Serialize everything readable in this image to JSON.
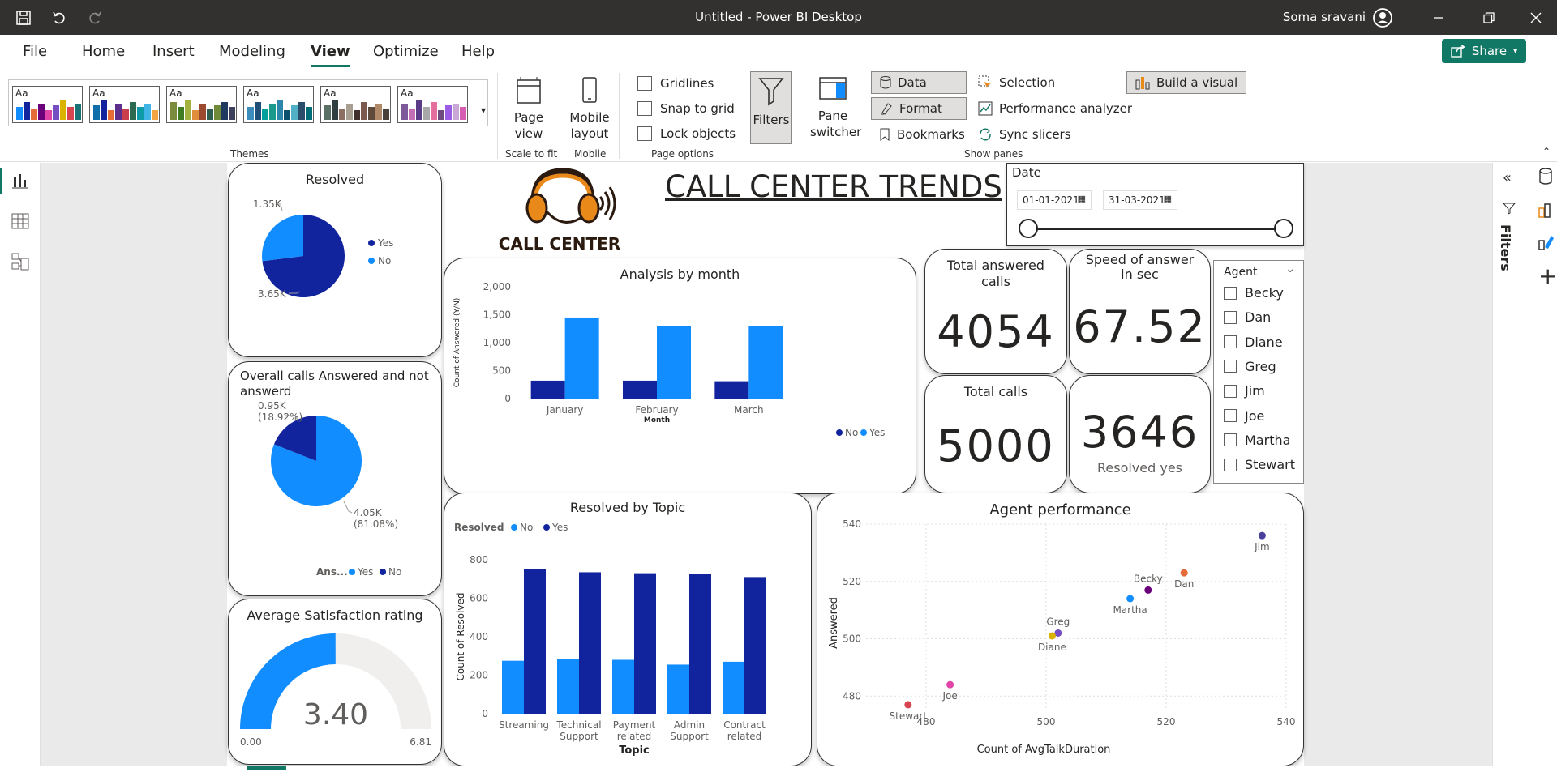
{
  "window": {
    "title": "Untitled - Power BI Desktop",
    "user": "Soma sravani"
  },
  "menu": {
    "tabs": [
      "File",
      "Home",
      "Insert",
      "Modeling",
      "View",
      "Optimize",
      "Help"
    ],
    "active": "View",
    "share_label": "Share"
  },
  "ribbon": {
    "themes_label": "Themes",
    "theme_aa": "Aa",
    "page_view": "Page view",
    "scale_to_fit": "Scale to fit",
    "mobile_layout": "Mobile layout",
    "mobile": "Mobile",
    "gridlines": "Gridlines",
    "snap_to_grid": "Snap to grid",
    "lock_objects": "Lock objects",
    "page_options": "Page options",
    "filters": "Filters",
    "pane_switcher": "Pane switcher",
    "data": "Data",
    "format": "Format",
    "bookmarks": "Bookmarks",
    "selection": "Selection",
    "performance_analyzer": "Performance analyzer",
    "sync_slicers": "Sync slicers",
    "build_visual": "Build a visual",
    "show_panes": "Show panes"
  },
  "right_pane": {
    "filters_label": "Filters"
  },
  "colors": {
    "accent": "#117865",
    "dark_blue": "#12239E",
    "light_blue": "#118DFF",
    "header_orange": "#E8891A"
  },
  "header": {
    "title": "CALL CENTER TRENDS",
    "logo_text": "CALL CENTER"
  },
  "date_slicer": {
    "label": "Date",
    "start": "01-01-2021",
    "end": "31-03-2021"
  },
  "agent_slicer": {
    "label": "Agent",
    "agents": [
      "Becky",
      "Dan",
      "Diane",
      "Greg",
      "Jim",
      "Joe",
      "Martha",
      "Stewart"
    ]
  },
  "kpis": {
    "total_answered": {
      "label": "Total answered calls",
      "value": "4054"
    },
    "speed_answer": {
      "label": "Speed of answer in sec",
      "value": "67.52"
    },
    "total_calls": {
      "label": "Total calls",
      "value": "5000"
    },
    "resolved_yes": {
      "label": "Resolved yes",
      "value": "3646"
    }
  },
  "gauge": {
    "title": "Average Satisfaction rating",
    "value": "3.40",
    "min": "0.00",
    "max": "6.81"
  },
  "chart_data": [
    {
      "type": "pie",
      "title": "Resolved",
      "labels": [
        "Yes",
        "No"
      ],
      "values": [
        3.65,
        1.35
      ],
      "value_labels": [
        "3.65K",
        "1.35K"
      ],
      "colors": [
        "#12239E",
        "#118DFF"
      ],
      "legend": "right"
    },
    {
      "type": "pie",
      "title": "Overall calls Answered and not answerd",
      "legend_title": "Ans...",
      "labels": [
        "Yes",
        "No"
      ],
      "values": [
        4.05,
        0.95
      ],
      "value_labels": [
        "4.05K\n(81.08%)",
        "0.95K\n(18.92%)"
      ],
      "colors": [
        "#118DFF",
        "#12239E"
      ],
      "legend": "bottom-right"
    },
    {
      "type": "bar",
      "title": "Analysis by month",
      "xlabel": "Month",
      "ylabel": "Count of Answered (Y/N)",
      "categories": [
        "January",
        "February",
        "March"
      ],
      "series": [
        {
          "name": "No",
          "values": [
            320,
            320,
            310
          ],
          "color": "#12239E"
        },
        {
          "name": "Yes",
          "values": [
            1450,
            1300,
            1300
          ],
          "color": "#118DFF"
        }
      ],
      "ylim": [
        0,
        2000
      ],
      "yticks": [
        "0",
        "500",
        "1,000",
        "1,500",
        "2,000"
      ],
      "legend": "bottom-right"
    },
    {
      "type": "bar",
      "title": "Resolved by Topic",
      "xlabel": "Topic",
      "ylabel": "Count of Resolved",
      "legend_title": "Resolved",
      "categories": [
        "Streaming",
        "Technical Support",
        "Payment related",
        "Admin Support",
        "Contract related"
      ],
      "series": [
        {
          "name": "No",
          "values": [
            275,
            285,
            280,
            255,
            270
          ],
          "color": "#118DFF"
        },
        {
          "name": "Yes",
          "values": [
            750,
            735,
            730,
            725,
            710
          ],
          "color": "#12239E"
        }
      ],
      "ylim": [
        0,
        800
      ],
      "yticks": [
        "0",
        "200",
        "400",
        "600",
        "800"
      ],
      "legend": "top-left"
    },
    {
      "type": "scatter",
      "title": "Agent performance",
      "xlabel": "Count of AvgTalkDuration",
      "ylabel": "Answered",
      "xlim": [
        470,
        540
      ],
      "ylim": [
        475,
        540
      ],
      "xticks": [
        "480",
        "500",
        "520",
        "540"
      ],
      "yticks": [
        "480",
        "500",
        "520",
        "540"
      ],
      "points": [
        {
          "label": "Jim",
          "x": 536,
          "y": 536,
          "color": "#4B3F9C"
        },
        {
          "label": "Dan",
          "x": 523,
          "y": 523,
          "color": "#E66C37"
        },
        {
          "label": "Becky",
          "x": 517,
          "y": 517,
          "color": "#6B007B"
        },
        {
          "label": "Martha",
          "x": 514,
          "y": 514,
          "color": "#118DFF"
        },
        {
          "label": "Greg",
          "x": 502,
          "y": 502,
          "color": "#744EC2"
        },
        {
          "label": "Diane",
          "x": 501,
          "y": 501,
          "color": "#D9B300"
        },
        {
          "label": "Joe",
          "x": 484,
          "y": 484,
          "color": "#E044A7"
        },
        {
          "label": "Stewart",
          "x": 477,
          "y": 477,
          "color": "#D64550"
        }
      ]
    }
  ]
}
